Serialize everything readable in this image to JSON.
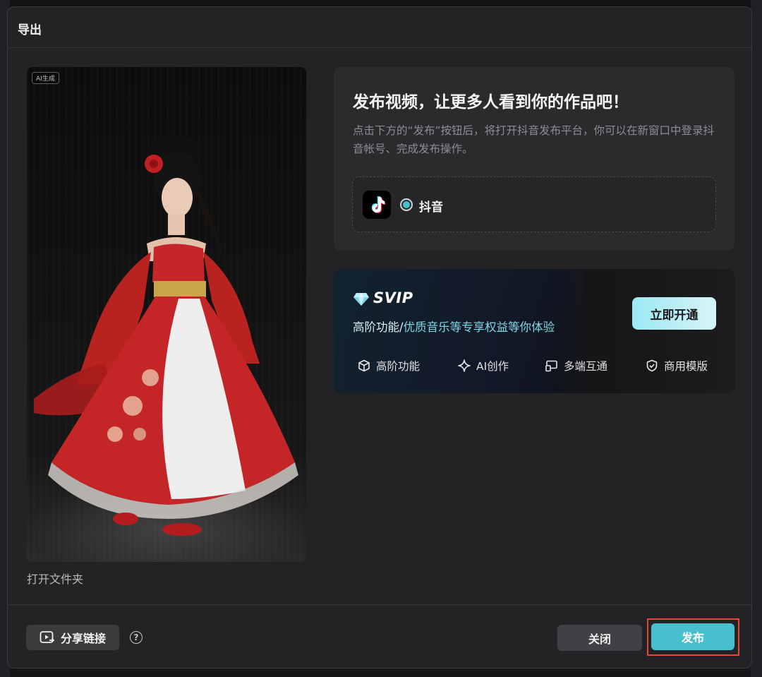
{
  "dialog": {
    "title": "导出"
  },
  "preview": {
    "ai_badge": "AI生成",
    "open_folder": "打开文件夹"
  },
  "publish": {
    "heading": "发布视频，让更多人看到你的作品吧！",
    "description": "点击下方的“发布”按钮后，将打开抖音发布平台，你可以在新窗口中登录抖音帐号、完成发布操作。",
    "platform": {
      "label": "抖音",
      "selected": true,
      "icon": "douyin-logo"
    }
  },
  "svip": {
    "title": "SVIP",
    "desc_part1": "高阶功能/",
    "desc_part2": "优质音乐等专享权益等你体验",
    "open_button": "立即开通",
    "features": [
      {
        "label": "高阶功能",
        "icon": "cube-icon"
      },
      {
        "label": "AI创作",
        "icon": "sparkle-icon"
      },
      {
        "label": "多端互通",
        "icon": "multi-device-icon"
      },
      {
        "label": "商用模版",
        "icon": "shield-check-icon"
      }
    ]
  },
  "footer": {
    "share_label": "分享链接",
    "help": "?",
    "close_label": "关闭",
    "publish_label": "发布"
  },
  "colors": {
    "accent": "#48bfcf",
    "highlight_frame": "#e04a3a"
  }
}
